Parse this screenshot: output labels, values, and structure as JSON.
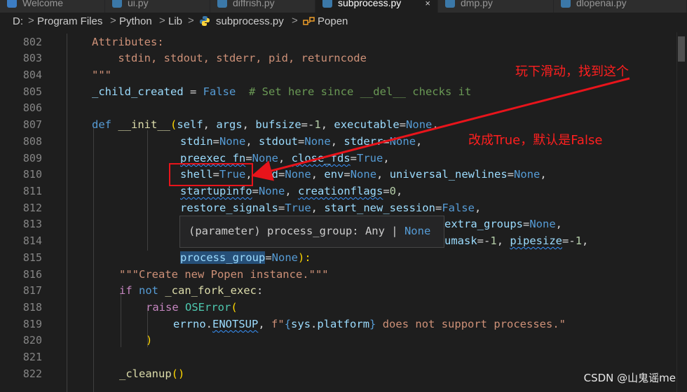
{
  "tabs": [
    {
      "label": "Welcome",
      "active": false
    },
    {
      "label": "ui.py",
      "active": false
    },
    {
      "label": "diffrish.py",
      "active": false
    },
    {
      "label": "subprocess.py",
      "active": true,
      "close": "×"
    },
    {
      "label": "dmp.py",
      "active": false
    },
    {
      "label": "dlopenai.py",
      "active": false
    }
  ],
  "breadcrumb": [
    "D:",
    "Program Files",
    "Python",
    "Lib",
    "subprocess.py",
    "Popen"
  ],
  "breadcrumb_separator": ">",
  "line_numbers": [
    "802",
    "803",
    "804",
    "805",
    "806",
    "807",
    "808",
    "809",
    "810",
    "811",
    "812",
    "813",
    "814",
    "815",
    "816",
    "817",
    "818",
    "819",
    "820",
    "821",
    "822"
  ],
  "code": {
    "l802": {
      "a": "Attributes:"
    },
    "l803": {
      "a": "    stdin, stdout, stderr, pid, returncode"
    },
    "l804": {
      "a": "\"\"\""
    },
    "l805": {
      "a": "_child_created",
      "b": " = ",
      "c": "False",
      "d": "  # Set here since __del__ checks it"
    },
    "l807": {
      "a": "def",
      "b": " __init__",
      "c": "(",
      "d": "self",
      "e": ", ",
      "f": "args",
      "g": ", ",
      "h": "bufsize",
      "i": "=-",
      "j": "1",
      "k": ", ",
      "l": "executable",
      "m": "=",
      "n": "None",
      "o": ","
    },
    "l808": {
      "a": "stdin",
      "b": "=",
      "c": "None",
      "d": ", ",
      "e": "stdout",
      "f": "=",
      "g": "None",
      "h": ", ",
      "i": "stderr",
      "j": "=",
      "k": "None",
      "l": ","
    },
    "l809": {
      "a": "preexec_fn",
      "b": "=",
      "c": "None",
      "d": ", ",
      "e": "close_fds",
      "f": "=",
      "g": "True",
      "h": ","
    },
    "l810": {
      "a": "shell",
      "b": "=",
      "c": "True",
      "d": ", ",
      "e": "cwd",
      "f": "=",
      "g": "None",
      "h": ", ",
      "i": "env",
      "j": "=",
      "k": "None",
      "l": ", ",
      "m": "universal_newlines",
      "n": "=",
      "o": "None",
      "p": ","
    },
    "l811": {
      "a": "startupinfo",
      "b": "=",
      "c": "None",
      "d": ", ",
      "e": "creationflags",
      "f": "=",
      "g": "0",
      "h": ","
    },
    "l812": {
      "a": "restore_signals",
      "b": "=",
      "c": "True",
      "d": ", ",
      "e": "start_new_session",
      "f": "=",
      "g": "False",
      "h": ","
    },
    "l813": {
      "a": "extra_groups",
      "b": "=",
      "c": "None",
      "d": ","
    },
    "l814": {
      "a": "umask",
      "b": "=-",
      "c": "1",
      "d": ", ",
      "e": "pipesize",
      "f": "=-",
      "g": "1",
      "h": ","
    },
    "l815": {
      "a": "process_group",
      "b": "=",
      "c": "None",
      "d": "):"
    },
    "l816": {
      "a": "\"\"\"Create new Popen instance.\"\"\""
    },
    "l817": {
      "a": "if",
      "b": " not",
      "c": " _can_fork_exec",
      "d": ":"
    },
    "l818": {
      "a": "raise",
      "b": " OSError",
      "c": "("
    },
    "l819": {
      "a": "errno",
      "b": ".",
      "c": "ENOTSUP",
      "d": ", ",
      "e": "f\"",
      "f": "{",
      "g": "sys",
      "h": ".",
      "i": "platform",
      "j": "}",
      "k": " does not support processes.\""
    },
    "l820": {
      "a": ")"
    },
    "l822": {
      "a": "_cleanup",
      "b": "()"
    }
  },
  "tooltip": {
    "prefix": "(parameter) process_group: Any | ",
    "none": "None"
  },
  "annotations": {
    "scroll_hint": "玩下滑动，找到这个",
    "change_hint": "改成True，默认是False"
  },
  "watermark": "CSDN @山鬼谣me",
  "colors": {
    "annotation": "#e8141b",
    "keyword": "#569cd6",
    "string": "#ce9178",
    "comment": "#6a9955",
    "param": "#9cdcfe"
  }
}
